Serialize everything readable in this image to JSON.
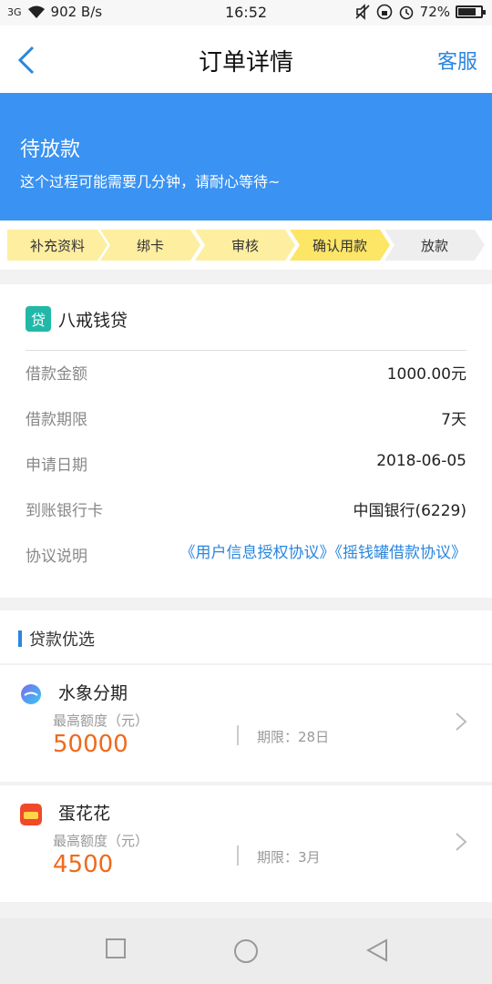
{
  "status_bar": {
    "signal": "3G",
    "speed": "902 B/s",
    "time": "16:52",
    "battery": "72%",
    "battery_level": 0.72
  },
  "nav": {
    "title": "订单详情",
    "service_label": "客服"
  },
  "banner": {
    "title": "待放款",
    "subtitle": "这个过程可能需要几分钟，请耐心等待~"
  },
  "steps": [
    {
      "label": "补充资料",
      "color": "#fdeea0"
    },
    {
      "label": "绑卡",
      "color": "#fdeea0"
    },
    {
      "label": "审核",
      "color": "#fdeea0"
    },
    {
      "label": "确认用款",
      "color": "#fde566"
    },
    {
      "label": "放款",
      "color": "#eeeeee"
    }
  ],
  "order": {
    "brand_icon": "贷",
    "brand_name": "八戒钱贷",
    "rows": [
      {
        "label": "借款金额",
        "value": "1000.00元"
      },
      {
        "label": "借款期限",
        "value": "7天"
      },
      {
        "label": "申请日期",
        "value": "2018-06-05"
      },
      {
        "label": "到账银行卡",
        "value": "中国银行(6229)"
      }
    ],
    "agreement_label": "协议说明",
    "agreement_text": "《用户信息授权协议》《摇钱罐借款协议》"
  },
  "loans": {
    "header": "贷款优选",
    "items": [
      {
        "name": "水象分期",
        "max_label": "最高额度（元）",
        "amount": "50000",
        "term": "期限：28日"
      },
      {
        "name": "蛋花花",
        "max_label": "最高额度（元）",
        "amount": "4500",
        "term": "期限：3月"
      }
    ]
  },
  "colors": {
    "accent": "#2a86de",
    "banner": "#3a92f2",
    "amount": "#ef6a1c"
  }
}
